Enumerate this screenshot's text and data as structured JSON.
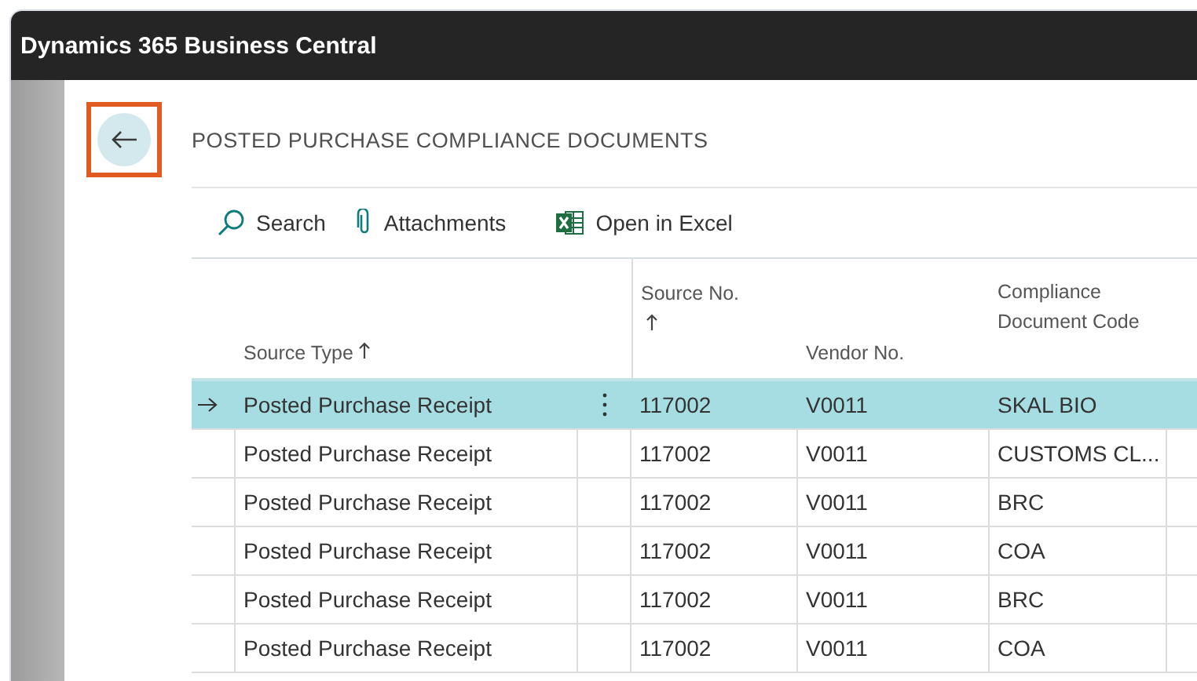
{
  "window": {
    "title": "Dynamics 365 Business Central"
  },
  "page": {
    "title": "POSTED PURCHASE COMPLIANCE DOCUMENTS",
    "back_highlighted": true
  },
  "actions": [
    {
      "kind": "search",
      "label": "Search"
    },
    {
      "kind": "attach",
      "label": "Attachments"
    },
    {
      "kind": "excel",
      "label": "Open in Excel"
    }
  ],
  "table": {
    "columns": [
      {
        "label": "Source Type",
        "sorted": true
      },
      {
        "label": "Source No.",
        "sorted": true
      },
      {
        "label": "Vendor No.",
        "sorted": false
      },
      {
        "label": "Compliance Document Code",
        "sorted": false
      }
    ],
    "rows": [
      {
        "selected": true,
        "cells": [
          "Posted Purchase Receipt",
          "117002",
          "V0011",
          "SKAL BIO"
        ]
      },
      {
        "selected": false,
        "cells": [
          "Posted Purchase Receipt",
          "117002",
          "V0011",
          "CUSTOMS CL..."
        ]
      },
      {
        "selected": false,
        "cells": [
          "Posted Purchase Receipt",
          "117002",
          "V0011",
          "BRC"
        ]
      },
      {
        "selected": false,
        "cells": [
          "Posted Purchase Receipt",
          "117002",
          "V0011",
          "COA"
        ]
      },
      {
        "selected": false,
        "cells": [
          "Posted Purchase Receipt",
          "117002",
          "V0011",
          "BRC"
        ]
      },
      {
        "selected": false,
        "cells": [
          "Posted Purchase Receipt",
          "117002",
          "V0011",
          "COA"
        ]
      }
    ]
  }
}
